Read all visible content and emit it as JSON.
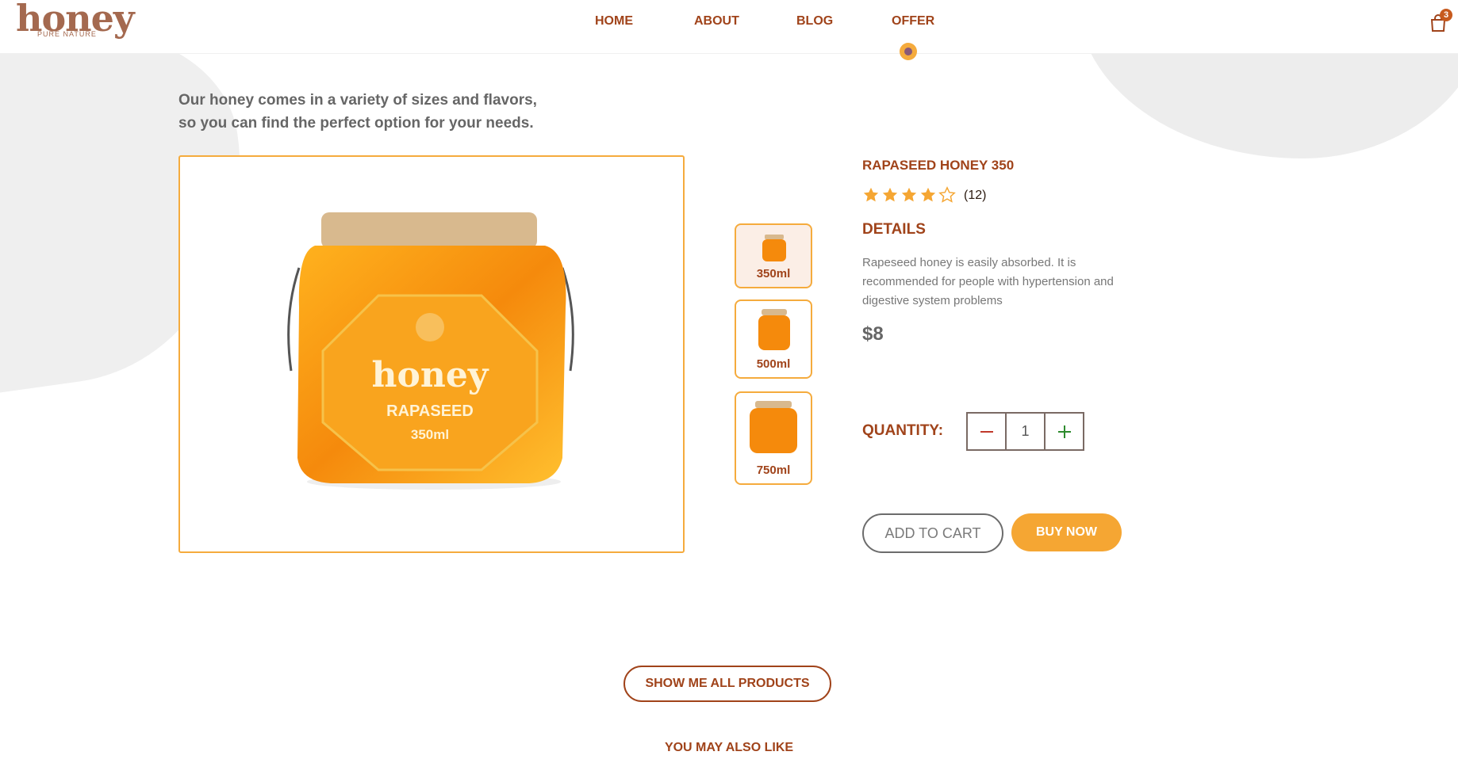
{
  "header": {
    "logo_text": "honey",
    "logo_sub": "PURE NATURE",
    "nav": [
      {
        "label": "HOME"
      },
      {
        "label": "ABOUT"
      },
      {
        "label": "BLOG"
      },
      {
        "label": "OFFER"
      }
    ],
    "cart_count": "3"
  },
  "intro_text": "Our honey comes in a variety of sizes and flavors, so you can find the perfect option for your needs.",
  "gallery": {
    "main_image_alt": "RAPASEED 350ml jar",
    "jar_brand": "honey",
    "jar_variety": "RAPASEED",
    "jar_size": "350ml",
    "thumbnails": [
      {
        "label": "350ml",
        "active": true
      },
      {
        "label": "500ml",
        "active": false
      },
      {
        "label": "750ml",
        "active": false
      }
    ]
  },
  "product": {
    "title": "RAPASEED HONEY 350",
    "rating": 4,
    "rating_max": 5,
    "reviews": "(12)",
    "details_heading": "DETAILS",
    "description": "Rapeseed honey is easily absorbed. It is recommended for people with hypertension and digestive system problems",
    "price": "$8",
    "quantity_label": "QUANTITY:",
    "quantity": "1",
    "add_to_cart": "ADD TO CART",
    "buy_now": "BUY NOW"
  },
  "show_all": "SHOW ME ALL PRODUCTS",
  "also_like": "YOU MAY ALSO LIKE",
  "colors": {
    "accent": "#f5ab3d",
    "brand_brown": "#a0431a",
    "minus": "#c0392b",
    "plus": "#2e8b2e"
  }
}
